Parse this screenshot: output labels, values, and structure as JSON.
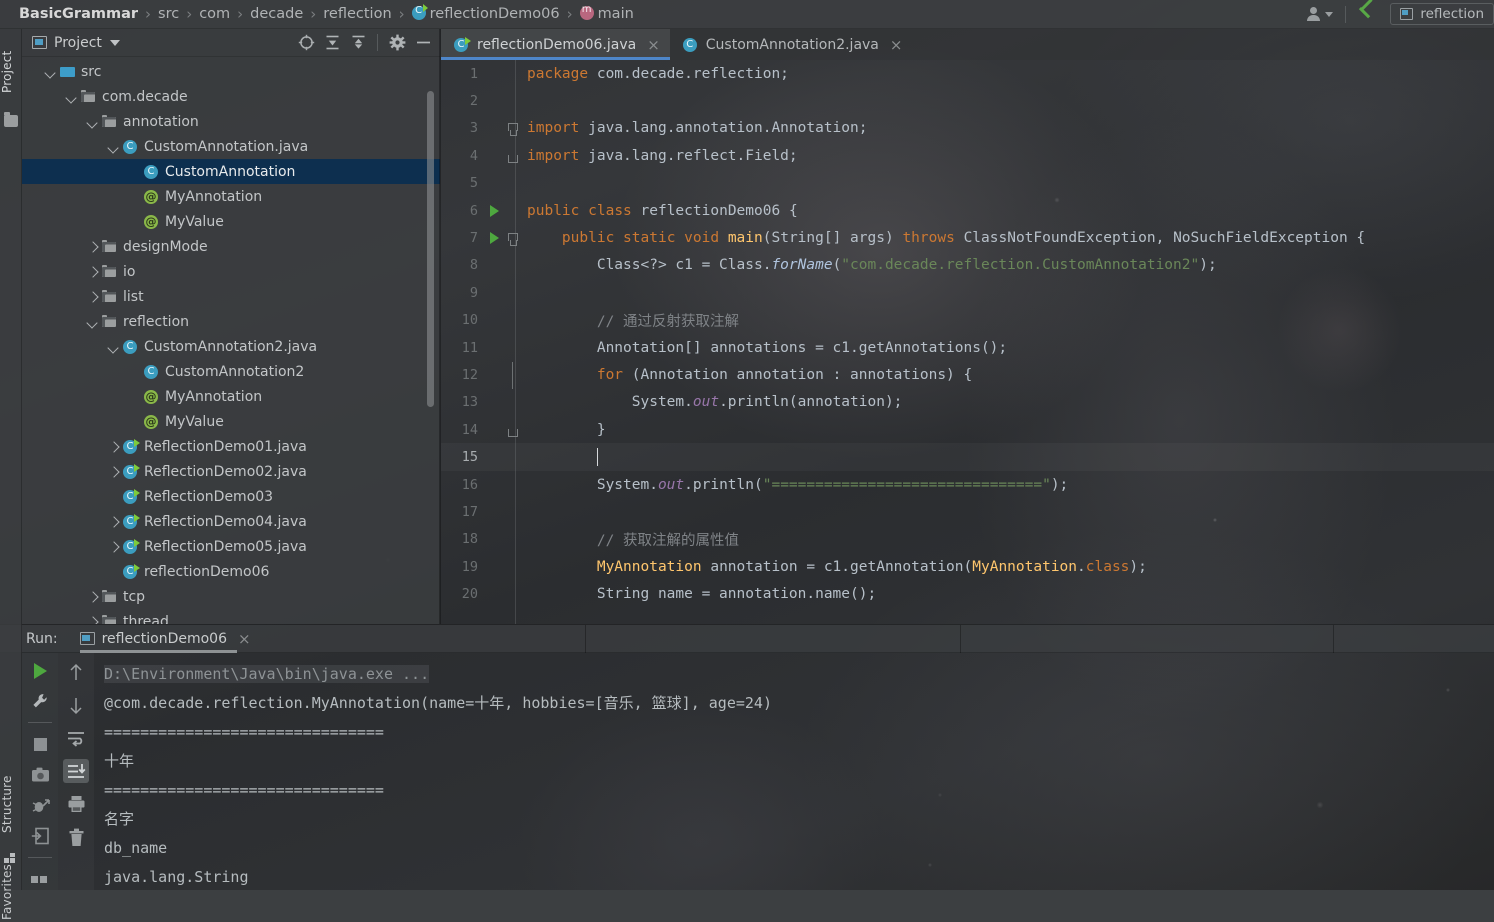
{
  "window": {
    "breadcrumb": [
      {
        "label": "BasicGrammar",
        "icon": null,
        "first": true
      },
      {
        "label": "src",
        "icon": null
      },
      {
        "label": "com",
        "icon": null
      },
      {
        "label": "decade",
        "icon": null
      },
      {
        "label": "reflection",
        "icon": null
      },
      {
        "label": "reflectionDemo06",
        "icon": "class-icon"
      },
      {
        "label": "main",
        "icon": "method-icon"
      }
    ],
    "separator": "›",
    "run_config_label": "reflection",
    "icons": {
      "person": "person-icon",
      "caret": "chevron-down-icon",
      "update": "update-project-icon",
      "run_config_window": "run-config-icon"
    }
  },
  "left_strip": {
    "tabs": [
      {
        "label": "Project",
        "icon": "folder-icon"
      },
      {
        "label": "Structure",
        "icon": "structure-icon"
      },
      {
        "label": "Favorites",
        "icon": "favorites-icon"
      }
    ]
  },
  "project_panel": {
    "title": "Project",
    "toolbar_icons": [
      "locate-icon",
      "expand-all-icon",
      "collapse-all-icon",
      "gear-icon",
      "hide-icon"
    ],
    "tree": [
      {
        "label": "src",
        "indent": 1,
        "twisty": "open",
        "icon": "src-folder-icon",
        "selected": false
      },
      {
        "label": "com.decade",
        "indent": 2,
        "twisty": "open",
        "icon": "package-icon",
        "selected": false
      },
      {
        "label": "annotation",
        "indent": 3,
        "twisty": "open",
        "icon": "package-icon",
        "selected": false
      },
      {
        "label": "CustomAnnotation.java",
        "indent": 4,
        "twisty": "open",
        "icon": "class-icon",
        "selected": false
      },
      {
        "label": "CustomAnnotation",
        "indent": 5,
        "twisty": "none",
        "icon": "class-icon",
        "selected": true
      },
      {
        "label": "MyAnnotation",
        "indent": 5,
        "twisty": "none",
        "icon": "annotation-icon",
        "selected": false
      },
      {
        "label": "MyValue",
        "indent": 5,
        "twisty": "none",
        "icon": "annotation-icon",
        "selected": false
      },
      {
        "label": "designMode",
        "indent": 3,
        "twisty": "closed",
        "icon": "package-icon",
        "selected": false
      },
      {
        "label": "io",
        "indent": 3,
        "twisty": "closed",
        "icon": "package-icon",
        "selected": false
      },
      {
        "label": "list",
        "indent": 3,
        "twisty": "closed",
        "icon": "package-icon",
        "selected": false
      },
      {
        "label": "reflection",
        "indent": 3,
        "twisty": "open",
        "icon": "package-icon",
        "selected": false
      },
      {
        "label": "CustomAnnotation2.java",
        "indent": 4,
        "twisty": "open",
        "icon": "class-icon",
        "selected": false
      },
      {
        "label": "CustomAnnotation2",
        "indent": 5,
        "twisty": "none",
        "icon": "class-icon",
        "selected": false
      },
      {
        "label": "MyAnnotation",
        "indent": 5,
        "twisty": "none",
        "icon": "annotation-icon",
        "selected": false
      },
      {
        "label": "MyValue",
        "indent": 5,
        "twisty": "none",
        "icon": "annotation-icon",
        "selected": false
      },
      {
        "label": "ReflectionDemo01.java",
        "indent": 4,
        "twisty": "closed",
        "icon": "runnable-class-icon",
        "selected": false
      },
      {
        "label": "ReflectionDemo02.java",
        "indent": 4,
        "twisty": "closed",
        "icon": "runnable-class-icon",
        "selected": false
      },
      {
        "label": "ReflectionDemo03",
        "indent": 4,
        "twisty": "none",
        "icon": "runnable-class-icon",
        "selected": false
      },
      {
        "label": "ReflectionDemo04.java",
        "indent": 4,
        "twisty": "closed",
        "icon": "runnable-class-icon",
        "selected": false
      },
      {
        "label": "ReflectionDemo05.java",
        "indent": 4,
        "twisty": "closed",
        "icon": "runnable-class-icon",
        "selected": false
      },
      {
        "label": "reflectionDemo06",
        "indent": 4,
        "twisty": "none",
        "icon": "runnable-class-icon",
        "selected": false
      },
      {
        "label": "tcp",
        "indent": 3,
        "twisty": "closed",
        "icon": "package-icon",
        "selected": false
      },
      {
        "label": "thread",
        "indent": 3,
        "twisty": "closed",
        "icon": "package-icon",
        "selected": false
      }
    ]
  },
  "editor": {
    "tabs": [
      {
        "label": "reflectionDemo06.java",
        "icon": "runnable-class-icon",
        "active": true,
        "close": "×"
      },
      {
        "label": "CustomAnnotation2.java",
        "icon": "class-icon",
        "active": false,
        "close": "×"
      }
    ],
    "caret_line": 15,
    "lines": [
      {
        "n": 1,
        "run": false,
        "fold": "",
        "html": "<span class=\"k\">package</span> <span class=\"id\">com.decade.reflection</span><span class=\"id\">;</span>"
      },
      {
        "n": 2,
        "run": false,
        "fold": "",
        "html": ""
      },
      {
        "n": 3,
        "run": false,
        "fold": "open",
        "html": "<span class=\"k\">import</span> <span class=\"id\">java.lang.annotation.Annotation</span><span class=\"id\">;</span>"
      },
      {
        "n": 4,
        "run": false,
        "fold": "end",
        "html": "<span class=\"k\">import</span> <span class=\"id\">java.lang.reflect.Field</span><span class=\"id\">;</span>"
      },
      {
        "n": 5,
        "run": false,
        "fold": "",
        "html": ""
      },
      {
        "n": 6,
        "run": true,
        "fold": "",
        "html": "<span class=\"k\">public</span> <span class=\"k\">class</span> <span class=\"id\">reflectionDemo06</span> <span class=\"id\">{</span>"
      },
      {
        "n": 7,
        "run": true,
        "fold": "open",
        "html": "    <span class=\"k\">public</span> <span class=\"k\">static</span> <span class=\"k\">void</span> <span class=\"fn\">main</span><span class=\"id\">(String[] args)</span> <span class=\"k\">throws</span> <span class=\"id\">ClassNotFoundException, NoSuchFieldException {</span>"
      },
      {
        "n": 8,
        "run": false,
        "fold": "",
        "html": "        <span class=\"id\">Class&lt;?&gt; c1 = Class.</span><span class=\"stfn\">forName</span><span class=\"id\">(</span><span class=\"str\">\"com.decade.reflection.CustomAnnotation2\"</span><span class=\"id\">);</span>"
      },
      {
        "n": 9,
        "run": false,
        "fold": "",
        "html": ""
      },
      {
        "n": 10,
        "run": false,
        "fold": "",
        "html": "        <span class=\"cmt\">// 通过反射获取注解</span>"
      },
      {
        "n": 11,
        "run": false,
        "fold": "",
        "html": "        <span class=\"id\">Annotation[] annotations = c1.getAnnotations();</span>"
      },
      {
        "n": 12,
        "run": false,
        "fold": "mid",
        "html": "        <span class=\"k\">for</span> <span class=\"id\">(Annotation annotation : annotations) {</span>"
      },
      {
        "n": 13,
        "run": false,
        "fold": "",
        "html": "            <span class=\"id\">System.</span><span class=\"fld\">out</span><span class=\"id\">.println(annotation);</span>"
      },
      {
        "n": 14,
        "run": false,
        "fold": "end",
        "html": "        <span class=\"id\">}</span>"
      },
      {
        "n": 15,
        "run": false,
        "fold": "",
        "html": "        <span class=\"caret\"></span>",
        "highlight": true
      },
      {
        "n": 16,
        "run": false,
        "fold": "",
        "html": "        <span class=\"id\">System.</span><span class=\"fld\">out</span><span class=\"id\">.println(</span><span class=\"str\">\"===============================\"</span><span class=\"id\">);</span>"
      },
      {
        "n": 17,
        "run": false,
        "fold": "",
        "html": ""
      },
      {
        "n": 18,
        "run": false,
        "fold": "",
        "html": "        <span class=\"cmt\">// 获取注解的属性值</span>"
      },
      {
        "n": 19,
        "run": false,
        "fold": "",
        "html": "        <span class=\"ann\">MyAnnotation</span> <span class=\"id\">annotation = c1.getAnnotation(</span><span class=\"ann\">MyAnnotation</span><span class=\"id\">.</span><span class=\"k\">class</span><span class=\"id\">);</span>"
      },
      {
        "n": 20,
        "run": false,
        "fold": "",
        "html": "        <span class=\"id\">String name = annotation.name();</span>"
      }
    ]
  },
  "run_panel": {
    "label": "Run:",
    "tab_label": "reflectionDemo06",
    "tab_close": "×",
    "toolbar_left": [
      "run-icon",
      "settings-wrench-icon",
      "stop-icon",
      "camera-icon",
      "debug-icon",
      "export-icon",
      "layout-icon"
    ],
    "toolbar_right": [
      "up-arrow-icon",
      "down-arrow-icon",
      "soft-wrap-icon",
      "scroll-to-end-icon",
      "print-icon",
      "trash-icon"
    ],
    "console": [
      {
        "text": "D:\\Environment\\Java\\bin\\java.exe ...",
        "style": "cmd"
      },
      {
        "text": "@com.decade.reflection.MyAnnotation(name=十年, hobbies=[音乐, 篮球], age=24)",
        "style": "out"
      },
      {
        "text": "===============================",
        "style": "out"
      },
      {
        "text": "十年",
        "style": "out"
      },
      {
        "text": "===============================",
        "style": "out"
      },
      {
        "text": "名字",
        "style": "out"
      },
      {
        "text": "db_name",
        "style": "out"
      },
      {
        "text": "java.lang.String",
        "style": "out"
      }
    ]
  },
  "colors": {
    "accent_blue": "#4e86c9",
    "selection_blue": "#0d2f4f",
    "keyword_orange": "#cc7832",
    "string_green": "#6a8759",
    "method_yellow": "#ffc66d",
    "class_icon_blue": "#3b9dbf",
    "annotation_green": "#8ab849",
    "run_green": "#4ea83f",
    "panel_gray": "#3c3f41"
  }
}
